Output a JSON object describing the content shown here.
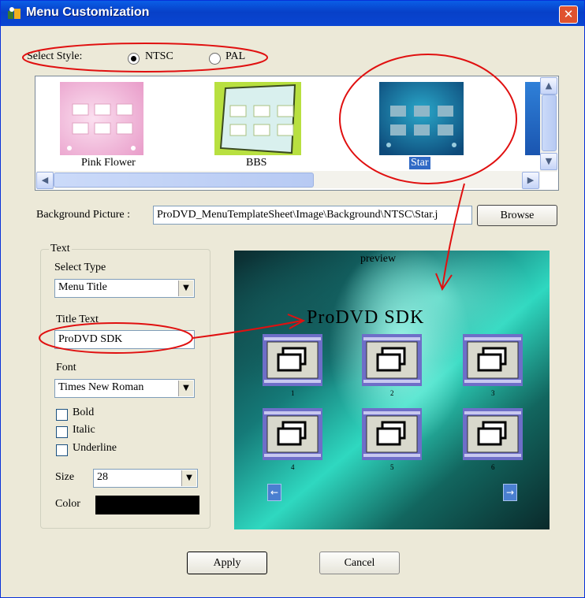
{
  "window": {
    "title": "Menu Customization",
    "close_glyph": "✕"
  },
  "style": {
    "label": "Select Style:",
    "options": [
      {
        "label": "NTSC",
        "selected": true
      },
      {
        "label": "PAL",
        "selected": false
      }
    ]
  },
  "templates": [
    {
      "name": "Pink Flower",
      "selected": false
    },
    {
      "name": "BBS",
      "selected": false
    },
    {
      "name": "Star",
      "selected": true
    }
  ],
  "background": {
    "label": "Background Picture :",
    "path": "ProDVD_MenuTemplateSheet\\Image\\Background\\NTSC\\Star.j",
    "browse_label": "Browse"
  },
  "text_group": {
    "legend": "Text",
    "select_type_label": "Select Type",
    "select_type_value": "Menu Title",
    "title_text_label": "Title Text",
    "title_text_value": "ProDVD SDK",
    "font_label": "Font",
    "font_value": "Times New Roman",
    "bold_label": "Bold",
    "italic_label": "Italic",
    "underline_label": "Underline",
    "size_label": "Size",
    "size_value": "28",
    "color_label": "Color",
    "color_value": "#000000"
  },
  "preview": {
    "label": "preview",
    "title": "ProDVD SDK",
    "tile_numbers": [
      "1",
      "2",
      "3",
      "4",
      "5",
      "6"
    ],
    "prev_glyph": "←",
    "next_glyph": "→"
  },
  "buttons": {
    "apply": "Apply",
    "cancel": "Cancel"
  },
  "annotation_color": "#e01010"
}
